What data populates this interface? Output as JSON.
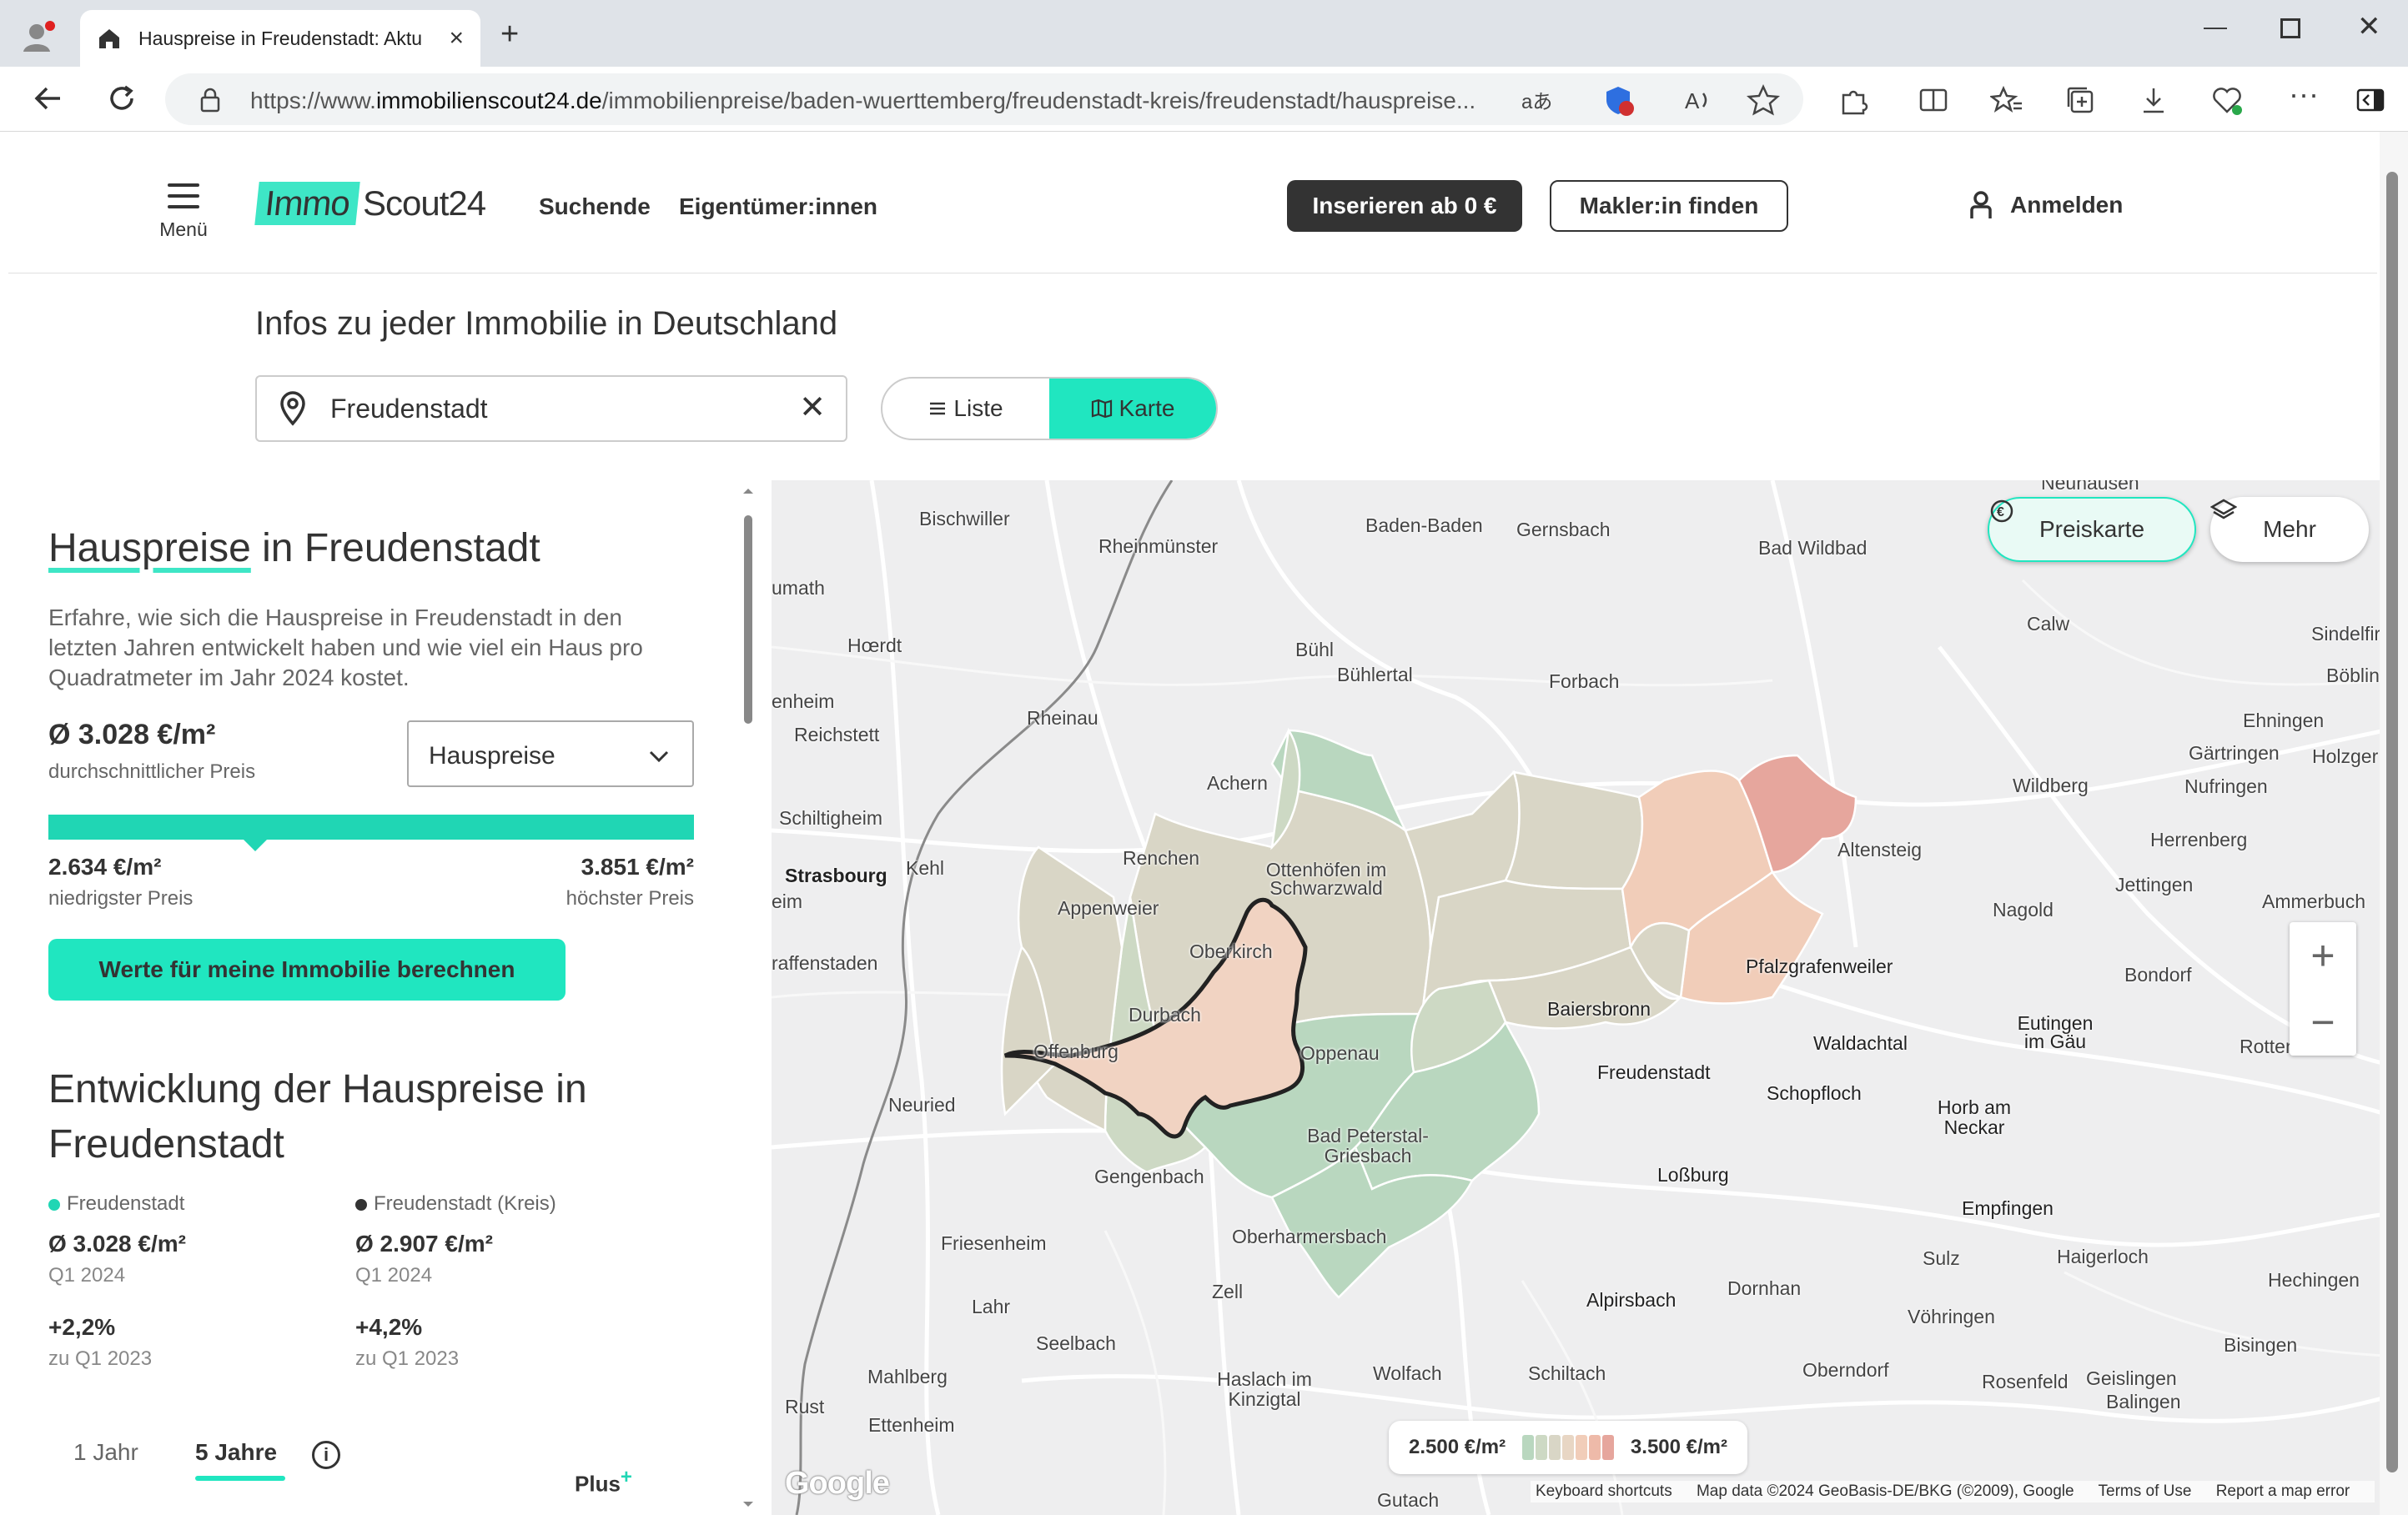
{
  "browser": {
    "tab_title": "Hauspreise in Freudenstadt: Aktu",
    "url_prefix": "https://www.",
    "url_domain": "immobilienscout24.de",
    "url_path": "/immobilienpreise/baden-wuerttemberg/freudenstadt-kreis/freudenstadt/hauspreise...",
    "url_action_translate": "aあ"
  },
  "header": {
    "menu_label": "Menü",
    "logo_immo": "Immo",
    "logo_scout": "Scout24",
    "nav": [
      "Suchende",
      "Eigentümer:innen"
    ],
    "insert_button": "Inserieren ab 0 €",
    "agent_button": "Makler:in finden",
    "login": "Anmelden"
  },
  "search": {
    "subtitle": "Infos zu jeder Immobilie in Deutschland",
    "value": "Freudenstadt",
    "clear": "✕",
    "view_list": "Liste",
    "view_map": "Karte",
    "active_view": "Karte"
  },
  "panel": {
    "title_highlight": "Hauspreise",
    "title_rest": " in Freudenstadt",
    "description": "Erfahre, wie sich die Hauspreise in Freudenstadt in den letzten Jahren entwickelt haben und wie viel ein Haus pro Quadratmeter im Jahr 2024 kostet.",
    "avg_price": "Ø 3.028 €/m²",
    "avg_label": "durchschnittlicher Preis",
    "type_select": "Hauspreise",
    "avg_position_fraction": 0.32,
    "min_price": "2.634 €/m²",
    "min_label": "niedrigster Preis",
    "max_price": "3.851 €/m²",
    "max_label": "höchster Preis",
    "cta": "Werte für meine Immobilie berechnen",
    "dev_title": "Entwicklung der Hauspreise in Freudenstadt",
    "compare": [
      {
        "name": "Freudenstadt",
        "color": "#20d6b4",
        "price": "Ø 3.028 €/m²",
        "period": "Q1 2024",
        "change": "+2,2%",
        "change_ref": "zu Q1 2023"
      },
      {
        "name": "Freudenstadt (Kreis)",
        "color": "#333333",
        "price": "Ø 2.907 €/m²",
        "period": "Q1 2024",
        "change": "+4,2%",
        "change_ref": "zu Q1 2023"
      }
    ],
    "range_tabs": [
      "1 Jahr",
      "5 Jahre"
    ],
    "active_range": "5 Jahre",
    "plus_label": "Plus",
    "plus_sup": "+"
  },
  "map": {
    "preiskarte": "Preiskarte",
    "mehr": "Mehr",
    "scale_min": "2.500 €/m²",
    "scale_max": "3.500 €/m²",
    "scale_colors": [
      "#b9d7bf",
      "#cdd9c4",
      "#d9d6c6",
      "#e8d6c4",
      "#f1cdb9",
      "#eebaa9",
      "#e6a69d"
    ],
    "zoom_in": "+",
    "zoom_out": "−",
    "google": "Google",
    "attribution": [
      "Keyboard shortcuts",
      "Map data ©2024 GeoBasis-DE/BKG (©2009), Google",
      "Terms of Use",
      "Report a map error"
    ],
    "places": [
      "Bischwiller",
      "Rheinmünster",
      "Baden-Baden",
      "Gernsbach",
      "Bad Wildbad",
      "Neuhausen",
      "umath",
      "Hœrdt",
      "Bühl",
      "Bühlertal",
      "Forbach",
      "Calw",
      "Sindelfir",
      "Böblin",
      "enheim",
      "Rheinau",
      "Reichstett",
      "Ehningen",
      "Gärtringen",
      "Holzger",
      "Nufringen",
      "Wildberg",
      "Achern",
      "Schiltigheim",
      "Altensteig",
      "Herrenberg",
      "Renchen",
      "Strasbourg",
      "Kehl",
      "Ottenhöfen im Schwarzwald",
      "Jettingen",
      "eim",
      "Appenweier",
      "Nagold",
      "Ammerbuch",
      "raffenstaden",
      "Oberkirch",
      "Pfalzgrafenweiler",
      "Bondorf",
      "Baiersbronn",
      "Durbach",
      "Eutingen im Gäu",
      "Offenburg",
      "Oppenau",
      "Waldachtal",
      "Rotten",
      "Freudenstadt",
      "Neuried",
      "Schopfloch",
      "Horb am Neckar",
      "Bad Peterstal-Griesbach",
      "Gengenbach",
      "Loßburg",
      "Empfingen",
      "Oberharmersbach",
      "Friesenheim",
      "Sulz",
      "Haigerloch",
      "Hechingen",
      "Zell",
      "Dornhan",
      "Alpirsbach",
      "Lahr",
      "Vöhringen",
      "Seelbach",
      "Bisingen",
      "Oberndorf",
      "Wolfach",
      "Schiltach",
      "Mahlberg",
      "Haslach im Kinzigtal",
      "Rosenfeld",
      "Geislingen",
      "Balingen",
      "Rust",
      "Ettenheim",
      "Gutach"
    ]
  }
}
